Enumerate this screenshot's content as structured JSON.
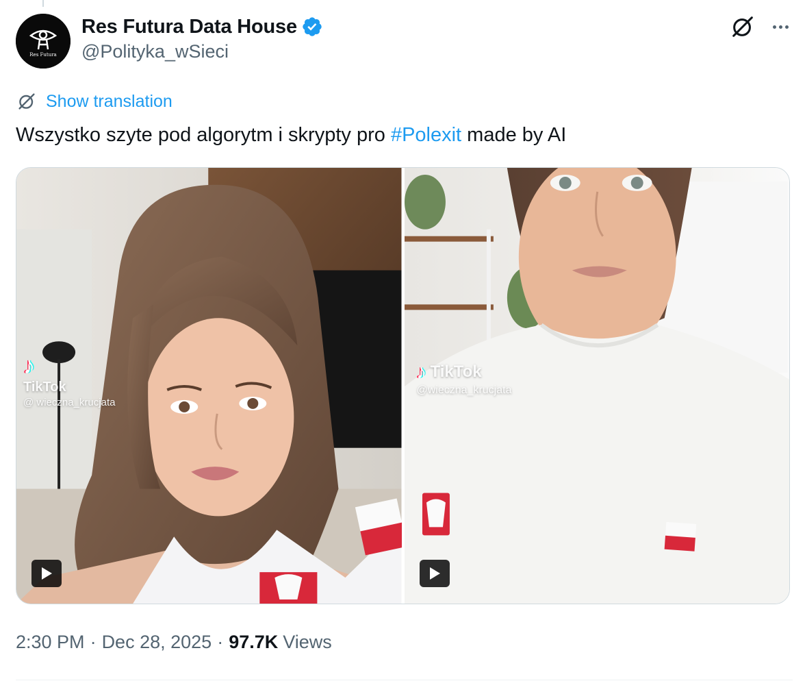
{
  "author": {
    "display_name": "Res Futura Data House",
    "handle": "@Polityka_wSieci",
    "verified": true,
    "avatar_text": "Res Futura"
  },
  "actions": {
    "grok_icon": "grok-icon",
    "more_icon": "more-horizontal-icon"
  },
  "translation": {
    "icon": "grok-icon",
    "label": "Show translation"
  },
  "post": {
    "text_before": "Wszystko szyte pod algorytm i skrypty pro ",
    "hashtag": "#Polexit",
    "text_after": " made by AI"
  },
  "media": [
    {
      "type": "video",
      "watermark_brand": "TikTok",
      "watermark_user": "@ wieczna_krucjata",
      "play_icon": "play-icon"
    },
    {
      "type": "video",
      "watermark_brand": "TikTok",
      "watermark_user": "@wieczna_krucjata",
      "play_icon": "play-icon"
    }
  ],
  "meta": {
    "time": "2:30 PM",
    "separator": "·",
    "date": "Dec 28, 2025",
    "views_count": "97.7K",
    "views_label": "Views"
  },
  "colors": {
    "accent": "#1d9bf0",
    "secondary_text": "#536471",
    "primary_text": "#0f1419"
  }
}
